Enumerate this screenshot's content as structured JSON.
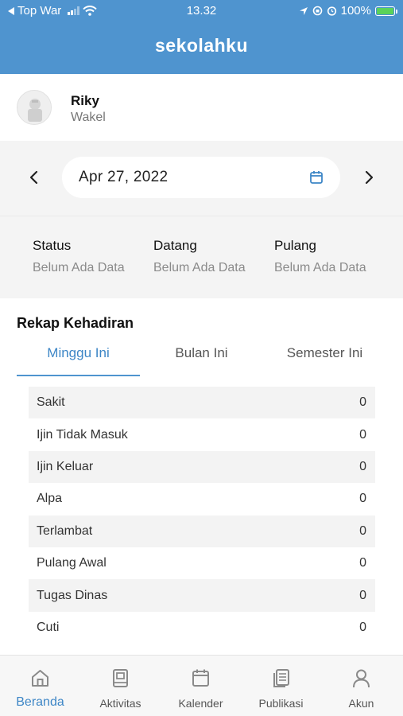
{
  "status_bar": {
    "carrier": "Top War",
    "time": "13.32",
    "battery": "100%"
  },
  "header": {
    "brand": "sekolahku"
  },
  "profile": {
    "name": "Riky",
    "role": "Wakel"
  },
  "date_picker": {
    "date": "Apr 27, 2022"
  },
  "attendance": [
    {
      "title": "Status",
      "value": "Belum Ada Data"
    },
    {
      "title": "Datang",
      "value": "Belum Ada Data"
    },
    {
      "title": "Pulang",
      "value": "Belum Ada Data"
    }
  ],
  "rekap": {
    "title": "Rekap Kehadiran",
    "tabs": [
      "Minggu Ini",
      "Bulan Ini",
      "Semester Ini"
    ],
    "active_tab": "Minggu Ini",
    "rows": [
      {
        "label": "Sakit",
        "value": "0"
      },
      {
        "label": "Ijin Tidak Masuk",
        "value": "0"
      },
      {
        "label": "Ijin Keluar",
        "value": "0"
      },
      {
        "label": "Alpa",
        "value": "0"
      },
      {
        "label": "Terlambat",
        "value": "0"
      },
      {
        "label": "Pulang Awal",
        "value": "0"
      },
      {
        "label": "Tugas Dinas",
        "value": "0"
      },
      {
        "label": "Cuti",
        "value": "0"
      }
    ]
  },
  "bottom_nav": [
    {
      "label": "Beranda",
      "icon": "home-icon"
    },
    {
      "label": "Aktivitas",
      "icon": "book-icon"
    },
    {
      "label": "Kalender",
      "icon": "calendar-icon"
    },
    {
      "label": "Publikasi",
      "icon": "documents-icon"
    },
    {
      "label": "Akun",
      "icon": "user-icon"
    }
  ],
  "colors": {
    "primary": "#4f94cf",
    "active": "#3d86c6"
  }
}
